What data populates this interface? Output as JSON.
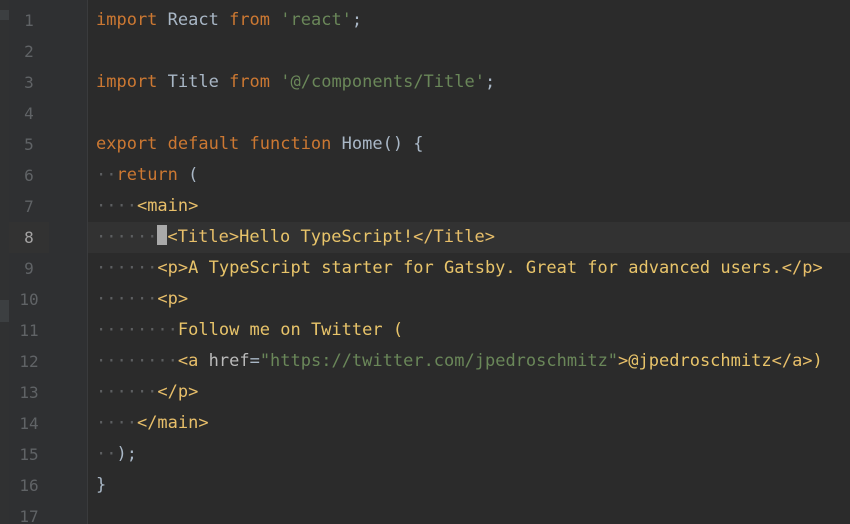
{
  "editor": {
    "lines": [
      {
        "n": "1",
        "indent": "",
        "tokens": [
          {
            "t": "import ",
            "c": "kw"
          },
          {
            "t": "React ",
            "c": "plain"
          },
          {
            "t": "from ",
            "c": "kw"
          },
          {
            "t": "'react'",
            "c": "str"
          },
          {
            "t": ";",
            "c": "plain"
          }
        ]
      },
      {
        "n": "2",
        "indent": "",
        "tokens": []
      },
      {
        "n": "3",
        "indent": "",
        "tokens": [
          {
            "t": "import ",
            "c": "kw"
          },
          {
            "t": "Title ",
            "c": "plain"
          },
          {
            "t": "from ",
            "c": "kw"
          },
          {
            "t": "'@/components/Title'",
            "c": "str"
          },
          {
            "t": ";",
            "c": "plain"
          }
        ]
      },
      {
        "n": "4",
        "indent": "",
        "tokens": []
      },
      {
        "n": "5",
        "indent": "",
        "tokens": [
          {
            "t": "export default function ",
            "c": "kw"
          },
          {
            "t": "Home() {",
            "c": "plain"
          }
        ]
      },
      {
        "n": "6",
        "indent": "··",
        "tokens": [
          {
            "t": "return ",
            "c": "kw"
          },
          {
            "t": "(",
            "c": "plain"
          }
        ]
      },
      {
        "n": "7",
        "indent": "····",
        "tokens": [
          {
            "t": "<main>",
            "c": "tag"
          }
        ]
      },
      {
        "n": "8",
        "indent": "······",
        "tokens": [
          {
            "t": "CARET",
            "c": "caret"
          },
          {
            "t": "<Title>",
            "c": "tag"
          },
          {
            "t": "Hello TypeScript!",
            "c": "jsxtext"
          },
          {
            "t": "</Title>",
            "c": "tag"
          }
        ]
      },
      {
        "n": "9",
        "indent": "······",
        "tokens": [
          {
            "t": "<p>",
            "c": "tag"
          },
          {
            "t": "A TypeScript starter for Gatsby. Great for advanced users.",
            "c": "jsxtext"
          },
          {
            "t": "</p>",
            "c": "tag"
          }
        ]
      },
      {
        "n": "10",
        "indent": "······",
        "tokens": [
          {
            "t": "<p>",
            "c": "tag"
          }
        ]
      },
      {
        "n": "11",
        "indent": "········",
        "tokens": [
          {
            "t": "Follow me on Twitter (",
            "c": "jsxtext"
          }
        ]
      },
      {
        "n": "12",
        "indent": "········",
        "tokens": [
          {
            "t": "<a ",
            "c": "tag"
          },
          {
            "t": "href",
            "c": "attr"
          },
          {
            "t": "=",
            "c": "plain"
          },
          {
            "t": "\"https://twitter.com/jpedroschmitz\"",
            "c": "str"
          },
          {
            "t": ">",
            "c": "tag"
          },
          {
            "t": "@jpedroschmitz",
            "c": "jsxtext"
          },
          {
            "t": "</a>",
            "c": "tag"
          },
          {
            "t": ")",
            "c": "jsxtext"
          }
        ]
      },
      {
        "n": "13",
        "indent": "······",
        "tokens": [
          {
            "t": "</p>",
            "c": "tag"
          }
        ]
      },
      {
        "n": "14",
        "indent": "····",
        "tokens": [
          {
            "t": "</main>",
            "c": "tag"
          }
        ]
      },
      {
        "n": "15",
        "indent": "··",
        "tokens": [
          {
            "t": ");",
            "c": "plain"
          }
        ]
      },
      {
        "n": "16",
        "indent": "",
        "tokens": [
          {
            "t": "}",
            "c": "plain"
          }
        ]
      },
      {
        "n": "17",
        "indent": "",
        "tokens": []
      }
    ],
    "current_line": "8",
    "colors": {
      "background": "#2b2b2b",
      "gutter": "#2f3032",
      "keyword": "#cc7832",
      "string": "#6a8759",
      "tag": "#e8bf6a",
      "jsx_text": "#e8c46a",
      "line_number": "#606366"
    }
  }
}
